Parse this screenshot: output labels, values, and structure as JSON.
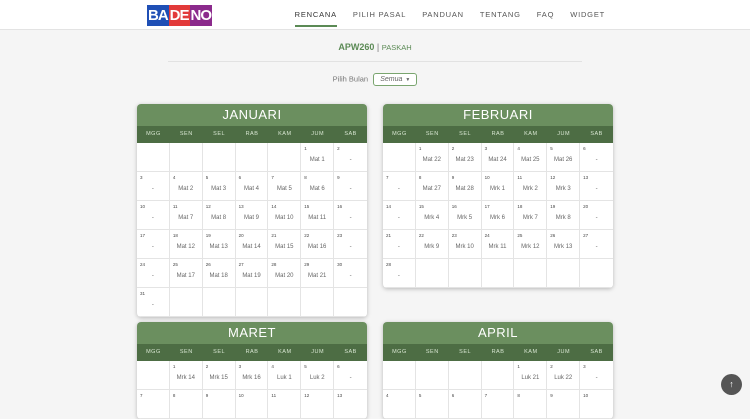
{
  "logo": {
    "part1": "BA",
    "part2": "DE",
    "part3": "NO"
  },
  "nav": [
    "RENCANA",
    "PILIH PASAL",
    "PANDUAN",
    "TENTANG",
    "FAQ",
    "WIDGET"
  ],
  "header": {
    "code": "APW260",
    "separator": "|",
    "subtitle": "PASKAH"
  },
  "filter": {
    "label": "Pilih Bulan",
    "value": "Semua"
  },
  "dow": [
    "MGG",
    "SEN",
    "SEL",
    "RAB",
    "KAM",
    "JUM",
    "SAB"
  ],
  "months": [
    {
      "name": "JANUARI",
      "cells": [
        {
          "d": "",
          "t": ""
        },
        {
          "d": "",
          "t": ""
        },
        {
          "d": "",
          "t": ""
        },
        {
          "d": "",
          "t": ""
        },
        {
          "d": "",
          "t": ""
        },
        {
          "d": "1",
          "t": "Mat 1"
        },
        {
          "d": "2",
          "t": "-"
        },
        {
          "d": "3",
          "t": "-"
        },
        {
          "d": "4",
          "t": "Mat 2"
        },
        {
          "d": "5",
          "t": "Mat 3"
        },
        {
          "d": "6",
          "t": "Mat 4"
        },
        {
          "d": "7",
          "t": "Mat 5"
        },
        {
          "d": "8",
          "t": "Mat 6"
        },
        {
          "d": "9",
          "t": "-"
        },
        {
          "d": "10",
          "t": "-"
        },
        {
          "d": "11",
          "t": "Mat 7"
        },
        {
          "d": "12",
          "t": "Mat 8"
        },
        {
          "d": "13",
          "t": "Mat 9"
        },
        {
          "d": "14",
          "t": "Mat 10"
        },
        {
          "d": "15",
          "t": "Mat 11"
        },
        {
          "d": "16",
          "t": "-"
        },
        {
          "d": "17",
          "t": "-"
        },
        {
          "d": "18",
          "t": "Mat 12"
        },
        {
          "d": "19",
          "t": "Mat 13"
        },
        {
          "d": "20",
          "t": "Mat 14"
        },
        {
          "d": "21",
          "t": "Mat 15"
        },
        {
          "d": "22",
          "t": "Mat 16"
        },
        {
          "d": "23",
          "t": "-"
        },
        {
          "d": "24",
          "t": "-"
        },
        {
          "d": "25",
          "t": "Mat 17"
        },
        {
          "d": "26",
          "t": "Mat 18"
        },
        {
          "d": "27",
          "t": "Mat 19"
        },
        {
          "d": "28",
          "t": "Mat 20"
        },
        {
          "d": "29",
          "t": "Mat 21"
        },
        {
          "d": "30",
          "t": "-"
        },
        {
          "d": "31",
          "t": "-"
        }
      ]
    },
    {
      "name": "FEBRUARI",
      "cells": [
        {
          "d": "",
          "t": ""
        },
        {
          "d": "1",
          "t": "Mat 22"
        },
        {
          "d": "2",
          "t": "Mat 23"
        },
        {
          "d": "3",
          "t": "Mat 24"
        },
        {
          "d": "4",
          "t": "Mat 25"
        },
        {
          "d": "5",
          "t": "Mat 26"
        },
        {
          "d": "6",
          "t": "-"
        },
        {
          "d": "7",
          "t": "-"
        },
        {
          "d": "8",
          "t": "Mat 27"
        },
        {
          "d": "9",
          "t": "Mat 28"
        },
        {
          "d": "10",
          "t": "Mrk 1"
        },
        {
          "d": "11",
          "t": "Mrk 2"
        },
        {
          "d": "12",
          "t": "Mrk 3"
        },
        {
          "d": "13",
          "t": "-"
        },
        {
          "d": "14",
          "t": "-"
        },
        {
          "d": "15",
          "t": "Mrk 4"
        },
        {
          "d": "16",
          "t": "Mrk 5"
        },
        {
          "d": "17",
          "t": "Mrk 6"
        },
        {
          "d": "18",
          "t": "Mrk 7"
        },
        {
          "d": "19",
          "t": "Mrk 8"
        },
        {
          "d": "20",
          "t": "-"
        },
        {
          "d": "21",
          "t": "-"
        },
        {
          "d": "22",
          "t": "Mrk 9"
        },
        {
          "d": "23",
          "t": "Mrk 10"
        },
        {
          "d": "24",
          "t": "Mrk 11"
        },
        {
          "d": "25",
          "t": "Mrk 12"
        },
        {
          "d": "26",
          "t": "Mrk 13"
        },
        {
          "d": "27",
          "t": "-"
        },
        {
          "d": "28",
          "t": "-"
        }
      ]
    },
    {
      "name": "MARET",
      "cells": [
        {
          "d": "",
          "t": ""
        },
        {
          "d": "1",
          "t": "Mrk 14"
        },
        {
          "d": "2",
          "t": "Mrk 15"
        },
        {
          "d": "3",
          "t": "Mrk 16"
        },
        {
          "d": "4",
          "t": "Luk 1"
        },
        {
          "d": "5",
          "t": "Luk 2"
        },
        {
          "d": "6",
          "t": "-"
        },
        {
          "d": "7",
          "t": ""
        },
        {
          "d": "8",
          "t": ""
        },
        {
          "d": "9",
          "t": ""
        },
        {
          "d": "10",
          "t": ""
        },
        {
          "d": "11",
          "t": ""
        },
        {
          "d": "12",
          "t": ""
        },
        {
          "d": "13",
          "t": ""
        }
      ]
    },
    {
      "name": "APRIL",
      "cells": [
        {
          "d": "",
          "t": ""
        },
        {
          "d": "",
          "t": ""
        },
        {
          "d": "",
          "t": ""
        },
        {
          "d": "",
          "t": ""
        },
        {
          "d": "1",
          "t": "Luk 21"
        },
        {
          "d": "2",
          "t": "Luk 22"
        },
        {
          "d": "3",
          "t": "-"
        },
        {
          "d": "4",
          "t": ""
        },
        {
          "d": "5",
          "t": ""
        },
        {
          "d": "6",
          "t": ""
        },
        {
          "d": "7",
          "t": ""
        },
        {
          "d": "8",
          "t": ""
        },
        {
          "d": "9",
          "t": ""
        },
        {
          "d": "10",
          "t": ""
        }
      ]
    }
  ],
  "scroll_top": {
    "icon": "arrow-up-icon",
    "glyph": "↑"
  }
}
